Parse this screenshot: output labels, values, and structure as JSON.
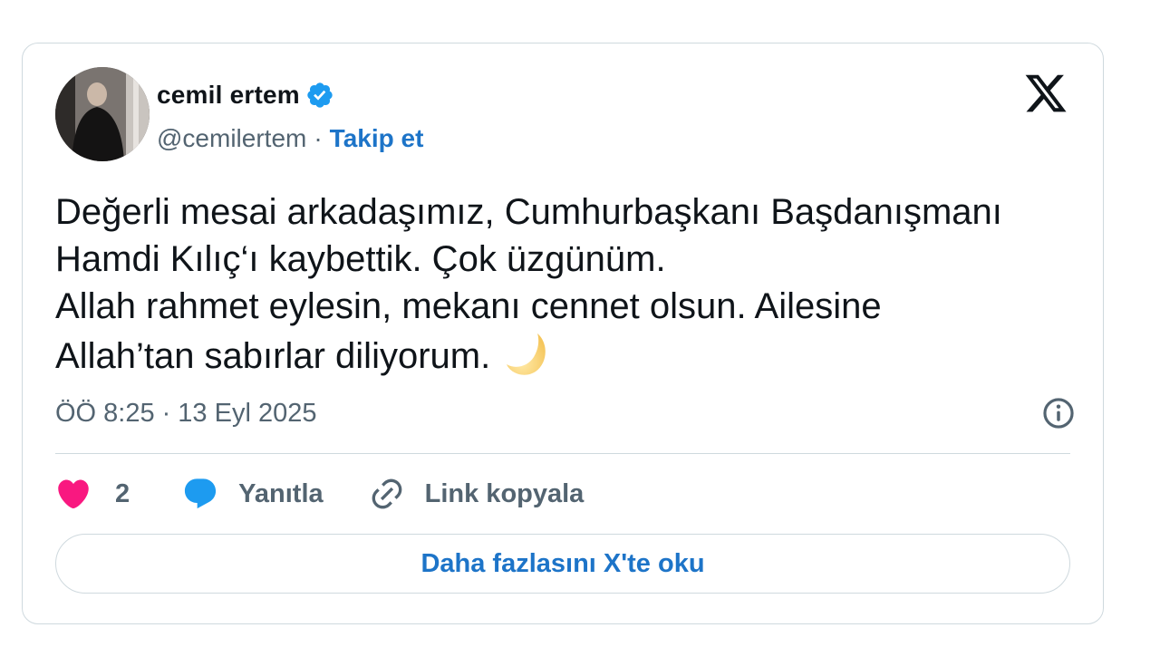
{
  "author": {
    "display_name": "cemil ertem",
    "handle": "@cemilertem",
    "separator": "·",
    "follow_label": "Takip et",
    "verified_color": "#1d9bf0"
  },
  "tweet": {
    "lines": [
      "Değerli mesai arkadaşımız, Cumhurbaşkanı Başdanışmanı",
      "Hamdi Kılıç‘ı kaybettik. Çok üzgünüm.",
      "Allah rahmet eylesin, mekanı cennet olsun. Ailesine",
      "Allah’tan sabırlar diliyorum."
    ],
    "emoji": "crescent-moon-icon"
  },
  "meta": {
    "time": "ÖÖ 8:25",
    "separator": "·",
    "date": "13 Eyl 2025"
  },
  "actions": {
    "like_count": "2",
    "reply_label": "Yanıtla",
    "copy_link_label": "Link kopyala",
    "like_color": "#f91880",
    "reply_color": "#1d9bf0"
  },
  "read_more_label": "Daha fazlasını X'te oku",
  "colors": {
    "link": "#1d74c8",
    "secondary_text": "#536471",
    "border": "#cfd9de"
  }
}
